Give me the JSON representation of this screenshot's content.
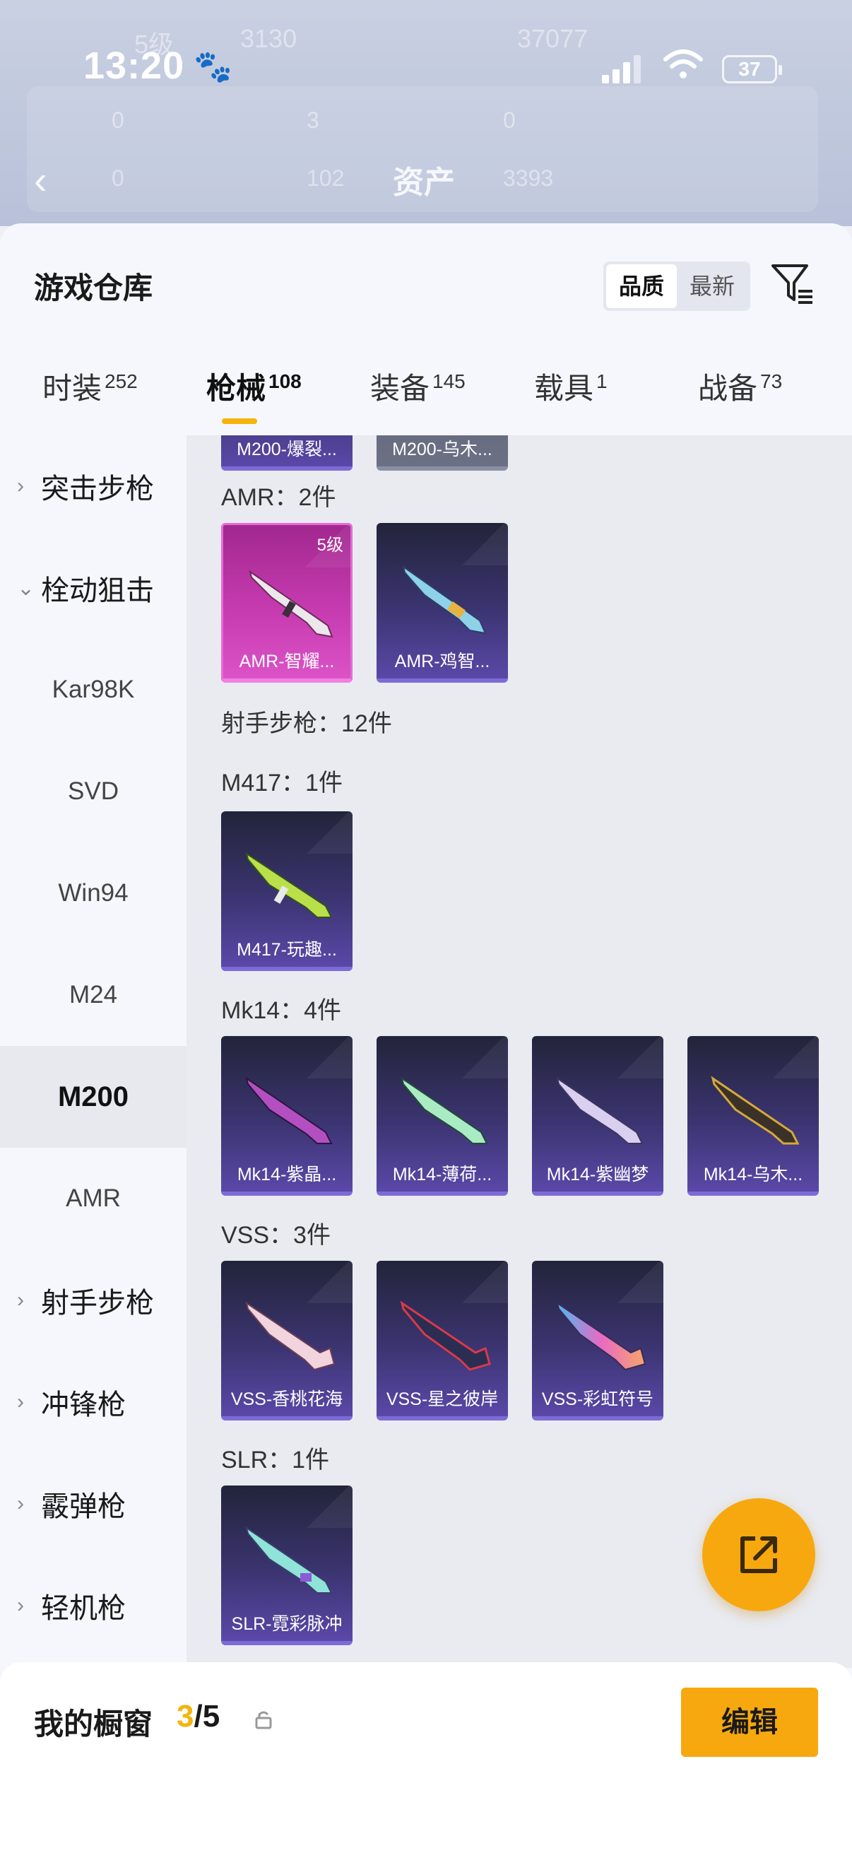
{
  "status_bar": {
    "time": "13:20",
    "battery": "37"
  },
  "background_header": {
    "title": "资产",
    "ghost_texts": [
      "5级",
      "3130",
      "37077",
      "0",
      "3",
      "0",
      "0",
      "102",
      "3393"
    ]
  },
  "header": {
    "title": "游戏仓库",
    "sort_options": [
      "品质",
      "最新"
    ],
    "active_sort": "品质"
  },
  "tabs": [
    {
      "label": "时装",
      "count": "252"
    },
    {
      "label": "枪械",
      "count": "108"
    },
    {
      "label": "装备",
      "count": "145"
    },
    {
      "label": "载具",
      "count": "1"
    },
    {
      "label": "战备",
      "count": "73"
    }
  ],
  "sidebar": {
    "items": [
      {
        "label": "突击步枪",
        "group": true,
        "expanded": false
      },
      {
        "label": "栓动狙击",
        "group": true,
        "expanded": true
      },
      {
        "label": "Kar98K",
        "group": false
      },
      {
        "label": "SVD",
        "group": false
      },
      {
        "label": "Win94",
        "group": false
      },
      {
        "label": "M24",
        "group": false
      },
      {
        "label": "M200",
        "group": false,
        "active": true
      },
      {
        "label": "AMR",
        "group": false
      },
      {
        "label": "射手步枪",
        "group": true,
        "expanded": false
      },
      {
        "label": "冲锋枪",
        "group": true,
        "expanded": false
      },
      {
        "label": "霰弹枪",
        "group": true,
        "expanded": false
      },
      {
        "label": "轻机枪",
        "group": true,
        "expanded": false
      }
    ]
  },
  "content": {
    "partial_cards": [
      "M200-爆裂...",
      "M200-乌木..."
    ],
    "sections": {
      "amr": "AMR：2件",
      "marksman": "射手步枪：12件",
      "m417": "M417：1件",
      "mk14": "Mk14：4件",
      "vss": "VSS：3件",
      "slr": "SLR：1件"
    },
    "cards": {
      "amr": [
        {
          "name": "AMR-智耀...",
          "level": "5级"
        },
        {
          "name": "AMR-鸡智..."
        }
      ],
      "m417": [
        {
          "name": "M417-玩趣..."
        }
      ],
      "mk14": [
        {
          "name": "Mk14-紫晶..."
        },
        {
          "name": "Mk14-薄荷..."
        },
        {
          "name": "Mk14-紫幽梦"
        },
        {
          "name": "Mk14-乌木..."
        }
      ],
      "vss": [
        {
          "name": "VSS-香桃花海"
        },
        {
          "name": "VSS-星之彼岸"
        },
        {
          "name": "VSS-彩虹符号"
        }
      ],
      "slr": [
        {
          "name": "SLR-霓彩脉冲"
        }
      ]
    }
  },
  "showcase": {
    "label": "我的橱窗",
    "current": "3",
    "total": "/5",
    "edit_label": "编辑"
  },
  "colors": {
    "accent": "#f7a80f",
    "tab_underline": "#f5b30c",
    "card_purple": "#5a48a8",
    "card_gold_pink": "#c93db3"
  },
  "icons": [
    "back-icon",
    "paw-icon",
    "signal-icon",
    "wifi-icon",
    "filter-icon",
    "chevron-right-icon",
    "chevron-down-icon",
    "share-icon",
    "lock-icon",
    "gun-icon"
  ]
}
